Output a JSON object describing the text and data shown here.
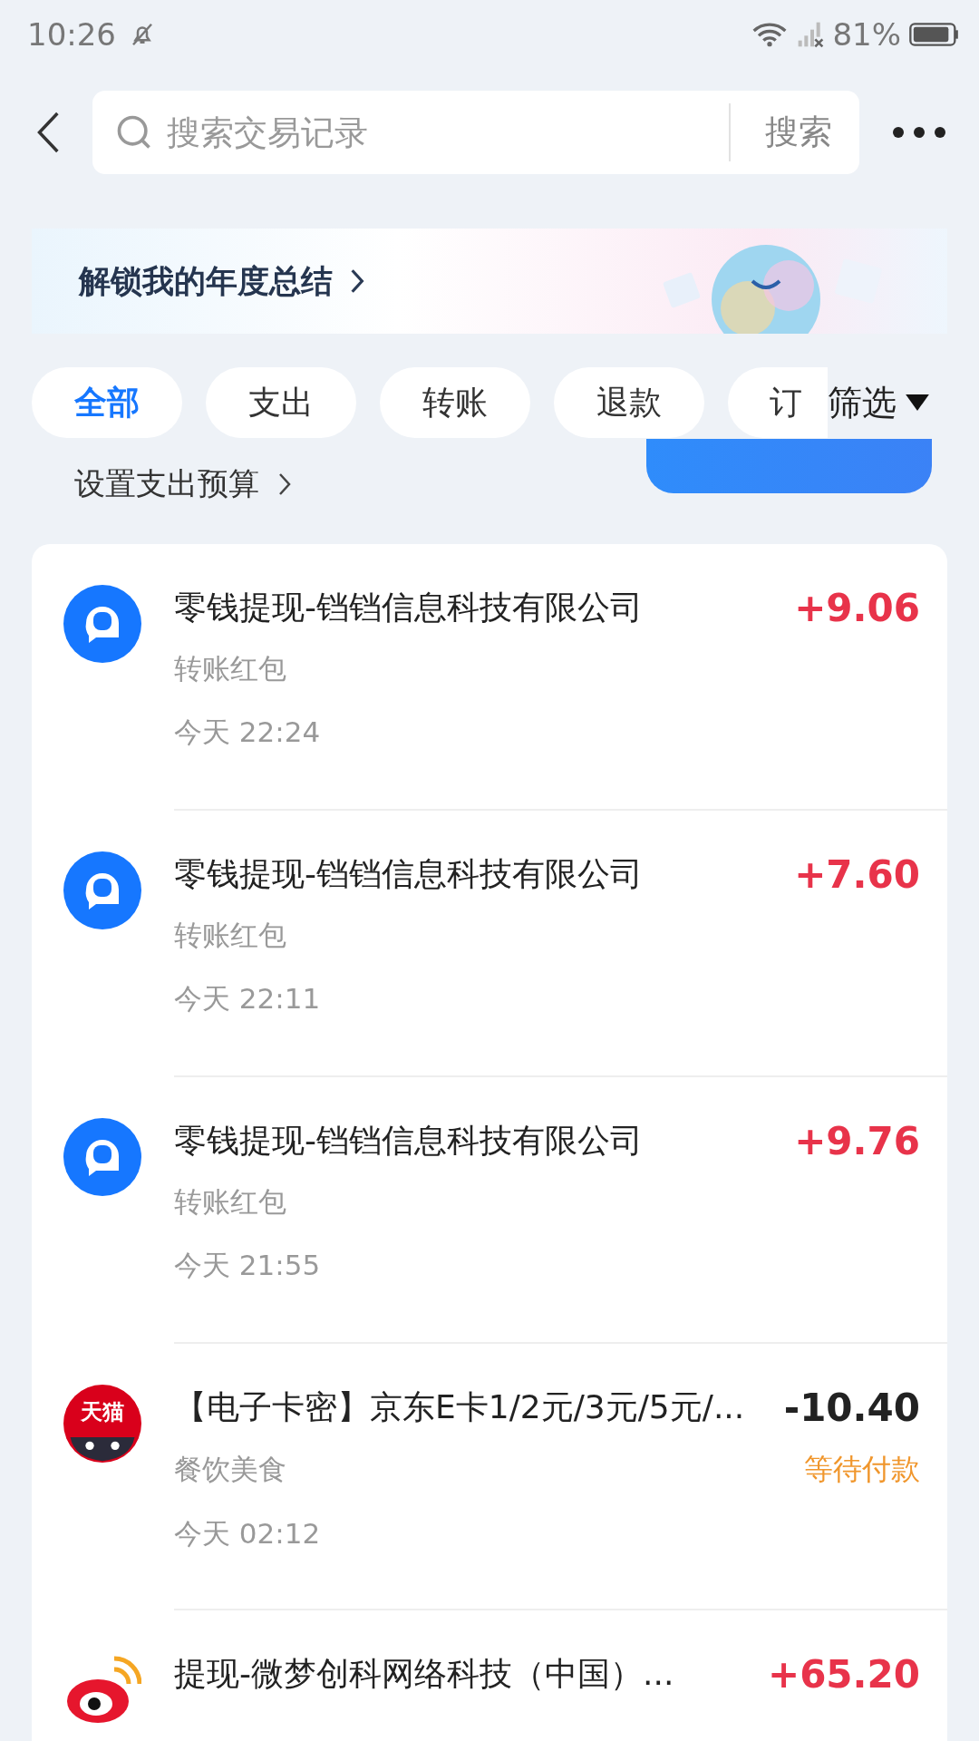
{
  "status_bar": {
    "time": "10:26",
    "battery": "81%"
  },
  "search": {
    "placeholder": "搜索交易记录",
    "button": "搜索"
  },
  "banner": {
    "title": "解锁我的年度总结"
  },
  "filters": [
    {
      "label": "全部",
      "selected": true
    },
    {
      "label": "支出",
      "selected": false
    },
    {
      "label": "转账",
      "selected": false
    },
    {
      "label": "退款",
      "selected": false
    },
    {
      "label": "订",
      "selected": false
    }
  ],
  "filter_button": "筛选",
  "budget_link": "设置支出预算",
  "transactions": [
    {
      "kind": "chat",
      "title": "零钱提现-铛铛信息科技有限公司",
      "category": "转账红包",
      "time": "今天 22:24",
      "amount": "+9.06",
      "income": true
    },
    {
      "kind": "chat",
      "title": "零钱提现-铛铛信息科技有限公司",
      "category": "转账红包",
      "time": "今天 22:11",
      "amount": "+7.60",
      "income": true
    },
    {
      "kind": "chat",
      "title": "零钱提现-铛铛信息科技有限公司",
      "category": "转账红包",
      "time": "今天 21:55",
      "amount": "+9.76",
      "income": true
    },
    {
      "kind": "shop",
      "icon_text": "天猫",
      "title": "【电子卡密】京东E卡1/2元/3元/5元/...",
      "category": "餐饮美食",
      "time": "今天 02:12",
      "amount": "-10.40",
      "income": false,
      "status": "等待付款"
    },
    {
      "kind": "eye",
      "title": "提现-微梦创科网络科技（中国）...",
      "amount": "+65.20",
      "income": true
    }
  ]
}
